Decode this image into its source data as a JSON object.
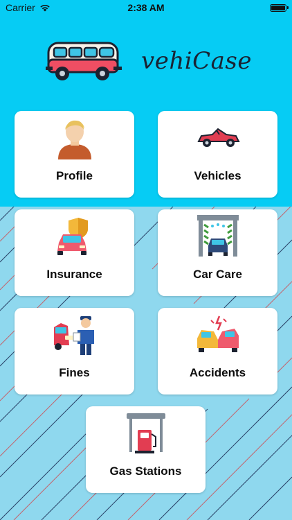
{
  "status_bar": {
    "carrier": "Carrier",
    "time": "2:38 AM",
    "battery_level": 1.0
  },
  "app": {
    "name": "vehiCase",
    "logo_icon": "van-icon"
  },
  "colors": {
    "header": "#06ccf4",
    "background": "#8fd8ee",
    "tile": "#ffffff",
    "label": "#0c0c0c"
  },
  "menu": [
    {
      "label": "Profile",
      "icon": "person-icon"
    },
    {
      "label": "Vehicles",
      "icon": "convertible-car-icon"
    },
    {
      "label": "Insurance",
      "icon": "insured-car-icon"
    },
    {
      "label": "Car Care",
      "icon": "car-wash-icon"
    },
    {
      "label": "Fines",
      "icon": "police-officer-icon"
    },
    {
      "label": "Accidents",
      "icon": "car-crash-icon"
    },
    {
      "label": "Gas Stations",
      "icon": "fuel-pump-icon"
    }
  ]
}
